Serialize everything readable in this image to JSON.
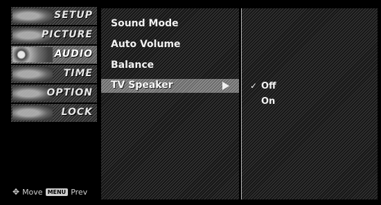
{
  "sidebar": {
    "tabs": [
      {
        "label": "SETUP",
        "icon": "setup-icon"
      },
      {
        "label": "PICTURE",
        "icon": "picture-icon"
      },
      {
        "label": "AUDIO",
        "icon": "audio-icon"
      },
      {
        "label": "TIME",
        "icon": "time-icon"
      },
      {
        "label": "OPTION",
        "icon": "option-icon"
      },
      {
        "label": "LOCK",
        "icon": "lock-icon"
      }
    ],
    "active_tab": "AUDIO",
    "hint": {
      "move_label": "Move",
      "menu_key": "MENU",
      "prev_label": "Prev"
    }
  },
  "submenu": {
    "items": [
      {
        "label": "Sound Mode"
      },
      {
        "label": "Auto Volume"
      },
      {
        "label": "Balance"
      },
      {
        "label": "TV Speaker"
      }
    ],
    "selected": "TV Speaker",
    "arrow_icon": "arrow-right-icon"
  },
  "options": {
    "items": [
      {
        "label": "Off",
        "checked": true
      },
      {
        "label": "On",
        "checked": false
      }
    ],
    "check_mark": "✓"
  }
}
